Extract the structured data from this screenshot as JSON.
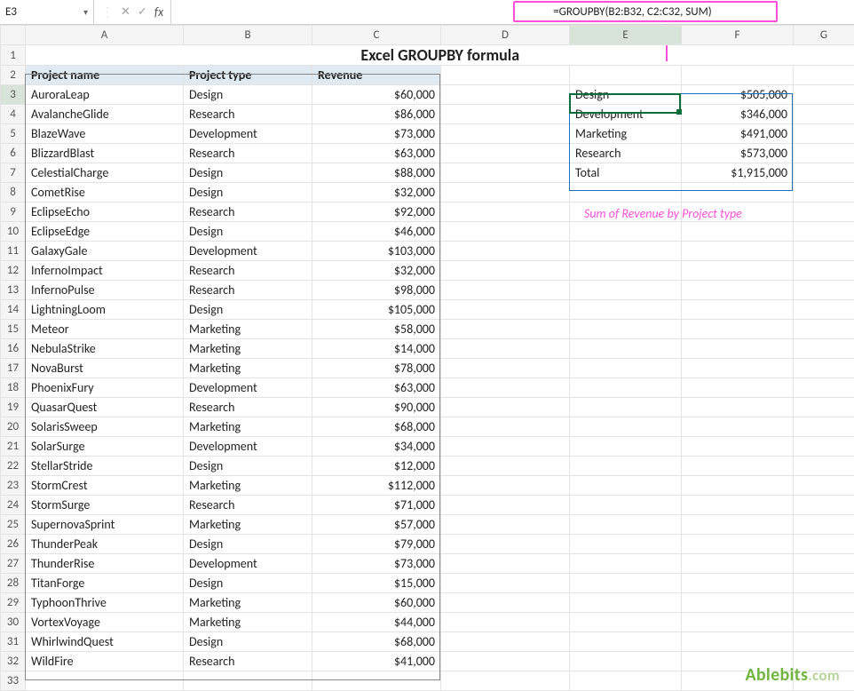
{
  "formula_bar": {
    "cell_ref": "E3",
    "fx_label": "fx",
    "formula": "=GROUPBY(B2:B32, C2:C32, SUM)"
  },
  "columns": [
    "A",
    "B",
    "C",
    "D",
    "E",
    "F",
    "G"
  ],
  "title": "Excel GROUPBY formula",
  "headers": {
    "A": "Project name",
    "B": "Project type",
    "C": "Revenue"
  },
  "rows": [
    {
      "n": 3,
      "a": "AuroraLeap",
      "b": "Design",
      "c": "$60,000"
    },
    {
      "n": 4,
      "a": "AvalancheGlide",
      "b": "Research",
      "c": "$86,000"
    },
    {
      "n": 5,
      "a": "BlazeWave",
      "b": "Development",
      "c": "$73,000"
    },
    {
      "n": 6,
      "a": "BlizzardBlast",
      "b": "Research",
      "c": "$63,000"
    },
    {
      "n": 7,
      "a": "CelestialCharge",
      "b": "Design",
      "c": "$88,000"
    },
    {
      "n": 8,
      "a": "CometRise",
      "b": "Design",
      "c": "$32,000"
    },
    {
      "n": 9,
      "a": "EclipseEcho",
      "b": "Research",
      "c": "$92,000"
    },
    {
      "n": 10,
      "a": "EclipseEdge",
      "b": "Design",
      "c": "$46,000"
    },
    {
      "n": 11,
      "a": "GalaxyGale",
      "b": "Development",
      "c": "$103,000"
    },
    {
      "n": 12,
      "a": "InfernoImpact",
      "b": "Research",
      "c": "$32,000"
    },
    {
      "n": 13,
      "a": "InfernoPulse",
      "b": "Research",
      "c": "$98,000"
    },
    {
      "n": 14,
      "a": "LightningLoom",
      "b": "Design",
      "c": "$105,000"
    },
    {
      "n": 15,
      "a": "Meteor",
      "b": "Marketing",
      "c": "$58,000"
    },
    {
      "n": 16,
      "a": "NebulaStrike",
      "b": "Marketing",
      "c": "$14,000"
    },
    {
      "n": 17,
      "a": "NovaBurst",
      "b": "Marketing",
      "c": "$78,000"
    },
    {
      "n": 18,
      "a": "PhoenixFury",
      "b": "Development",
      "c": "$63,000"
    },
    {
      "n": 19,
      "a": "QuasarQuest",
      "b": "Research",
      "c": "$90,000"
    },
    {
      "n": 20,
      "a": "SolarisSweep",
      "b": "Marketing",
      "c": "$68,000"
    },
    {
      "n": 21,
      "a": "SolarSurge",
      "b": "Development",
      "c": "$34,000"
    },
    {
      "n": 22,
      "a": "StellarStride",
      "b": "Design",
      "c": "$12,000"
    },
    {
      "n": 23,
      "a": "StormCrest",
      "b": "Marketing",
      "c": "$112,000"
    },
    {
      "n": 24,
      "a": "StormSurge",
      "b": "Research",
      "c": "$71,000"
    },
    {
      "n": 25,
      "a": "SupernovaSprint",
      "b": "Marketing",
      "c": "$57,000"
    },
    {
      "n": 26,
      "a": "ThunderPeak",
      "b": "Design",
      "c": "$79,000"
    },
    {
      "n": 27,
      "a": "ThunderRise",
      "b": "Development",
      "c": "$73,000"
    },
    {
      "n": 28,
      "a": "TitanForge",
      "b": "Design",
      "c": "$15,000"
    },
    {
      "n": 29,
      "a": "TyphoonThrive",
      "b": "Marketing",
      "c": "$60,000"
    },
    {
      "n": 30,
      "a": "VortexVoyage",
      "b": "Marketing",
      "c": "$44,000"
    },
    {
      "n": 31,
      "a": "WhirlwindQuest",
      "b": "Design",
      "c": "$68,000"
    },
    {
      "n": 32,
      "a": "WildFire",
      "b": "Research",
      "c": "$41,000"
    }
  ],
  "summary": [
    {
      "e": "Design",
      "f": "$505,000"
    },
    {
      "e": "Development",
      "f": "$346,000"
    },
    {
      "e": "Marketing",
      "f": "$491,000"
    },
    {
      "e": "Research",
      "f": "$573,000"
    },
    {
      "e": "Total",
      "f": "$1,915,000"
    }
  ],
  "caption": "Sum of Revenue by Project type",
  "watermark": {
    "brand": "Ablebits",
    "suffix": ".com"
  },
  "colors": {
    "callout": "#ff4fd8",
    "spill": "#1f6fb5",
    "active": "#0b6e3a"
  }
}
